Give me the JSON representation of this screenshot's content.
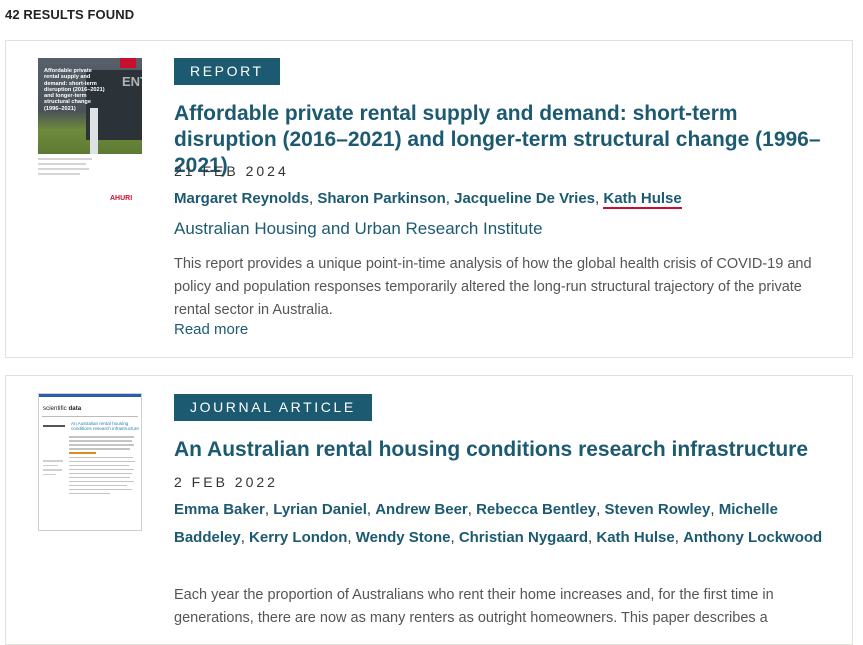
{
  "results": {
    "count_text": "42 RESULTS FOUND"
  },
  "items": [
    {
      "type": "REPORT",
      "title": "Affordable private rental supply and demand: short-term disruption (2016–2021) and longer-term structural change (1996–2021)",
      "date": "21 FEB 2024",
      "authors": [
        "Margaret Reynolds",
        "Sharon Parkinson",
        "Jacqueline De Vries",
        "Kath Hulse"
      ],
      "highlighted_author": "Kath Hulse",
      "publisher": "Australian Housing and Urban Research Institute",
      "abstract": "This report provides a unique point-in-time analysis of how the global health crisis of COVID-19 and policy and population responses temporarily altered the long-run structural trajectory of the private rental sector in Australia.",
      "read_more": "Read more",
      "thumbnail": {
        "cover_title": "Affordable private rental supply and demand: short-term disruption (2016–2021) and longer-term structural change (1996–2021)",
        "logo_text": "AHURI",
        "sign_text": "ENT"
      }
    },
    {
      "type": "JOURNAL ARTICLE",
      "title": "An Australian rental housing conditions research infrastructure",
      "date": "2 FEB 2022",
      "authors": [
        "Emma Baker",
        "Lyrian Daniel",
        "Andrew Beer",
        "Rebecca Bentley",
        "Steven Rowley",
        "Michelle Baddeley",
        "Kerry London",
        "Wendy Stone",
        "Christian Nygaard",
        "Kath Hulse",
        "Anthony Lockwood"
      ],
      "abstract": "Each year the proportion of Australians who rent their home increases and, for the first time in generations, there are now as many renters as outright homeowners. This paper describes a",
      "thumbnail": {
        "journal_prefix": "scientific",
        "journal_bold": "data",
        "cover_title": "An Australian rental housing conditions research infrastructure"
      }
    }
  ],
  "colors": {
    "accent": "#1c5a72",
    "highlight": "#c8102e",
    "badge_text": "#ffffff"
  }
}
